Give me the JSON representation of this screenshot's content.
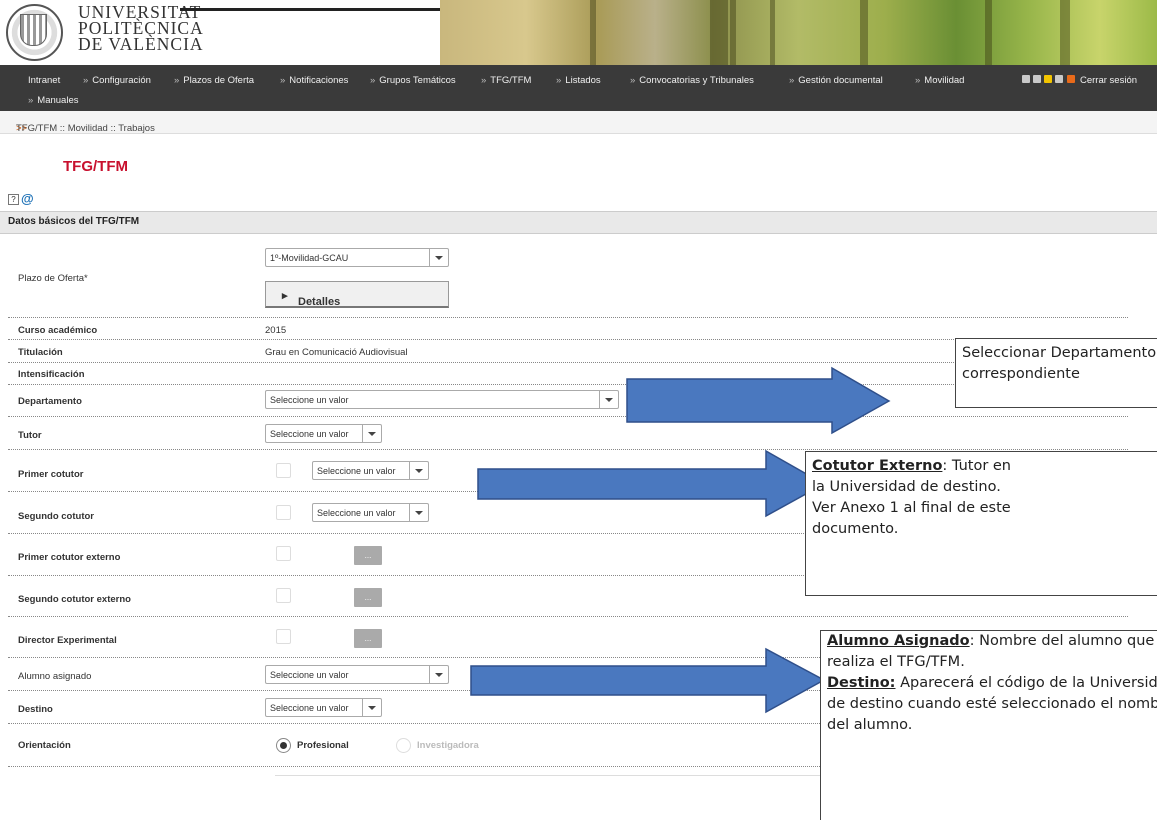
{
  "header": {
    "university_lines": [
      "UNIVERSITAT",
      "POLITÈCNICA",
      "DE VALÈNCIA"
    ]
  },
  "nav": {
    "items": [
      "Intranet",
      "Configuración",
      "Plazos de Oferta",
      "Notificaciones",
      "Grupos Temáticos",
      "TFG/TFM",
      "Listados",
      "Convocatorias y Tribunales",
      "Gestión documental",
      "Movilidad",
      "Manuales"
    ],
    "logout": "Cerrar sesión"
  },
  "breadcrumb": "TFG/TFM :: Movilidad :: Trabajos",
  "page_title": "TFG/TFM",
  "section_title": "Datos básicos del TFG/TFM",
  "form": {
    "plazo_label": "Plazo de Oferta*",
    "plazo_value": "1º-Movilidad-GCAU",
    "detalles_label": "Detalles",
    "curso_label": "Curso académico",
    "curso_value": "2015",
    "titulacion_label": "Titulación",
    "titulacion_value": "Grau en Comunicació Audiovisual",
    "intensificacion_label": "Intensificación",
    "departamento_label": "Departamento",
    "tutor_label": "Tutor",
    "primer_cotutor_label": "Primer cotutor",
    "segundo_cotutor_label": "Segundo cotutor",
    "primer_cotutor_externo_label": "Primer cotutor externo",
    "segundo_cotutor_externo_label": "Segundo cotutor externo",
    "director_label": "Director Experimental",
    "alumno_label": "Alumno asignado",
    "destino_label": "Destino",
    "orientacion_label": "Orientación",
    "orientacion_options": [
      "Profesional",
      "Investigadora"
    ],
    "orientacion_selected": "Profesional",
    "select_placeholder": "Seleccione un valor",
    "ellipsis_label": "..."
  },
  "callouts": {
    "c1": "Seleccionar Departamento y Tutor correspondiente",
    "c2_title": "Cotutor Externo",
    "c2_text": ": Tutor en la Universidad de destino. Ver Anexo 1 al final de este documento.",
    "c3_title1": "Alumno Asignado",
    "c3_text1": ": Nombre del alumno que realiza el TFG/TFM.",
    "c3_title2": "Destino:",
    "c3_text2": " Aparecerá el código de la Universidad de destino cuando esté seleccionado el nombre del alumno."
  }
}
